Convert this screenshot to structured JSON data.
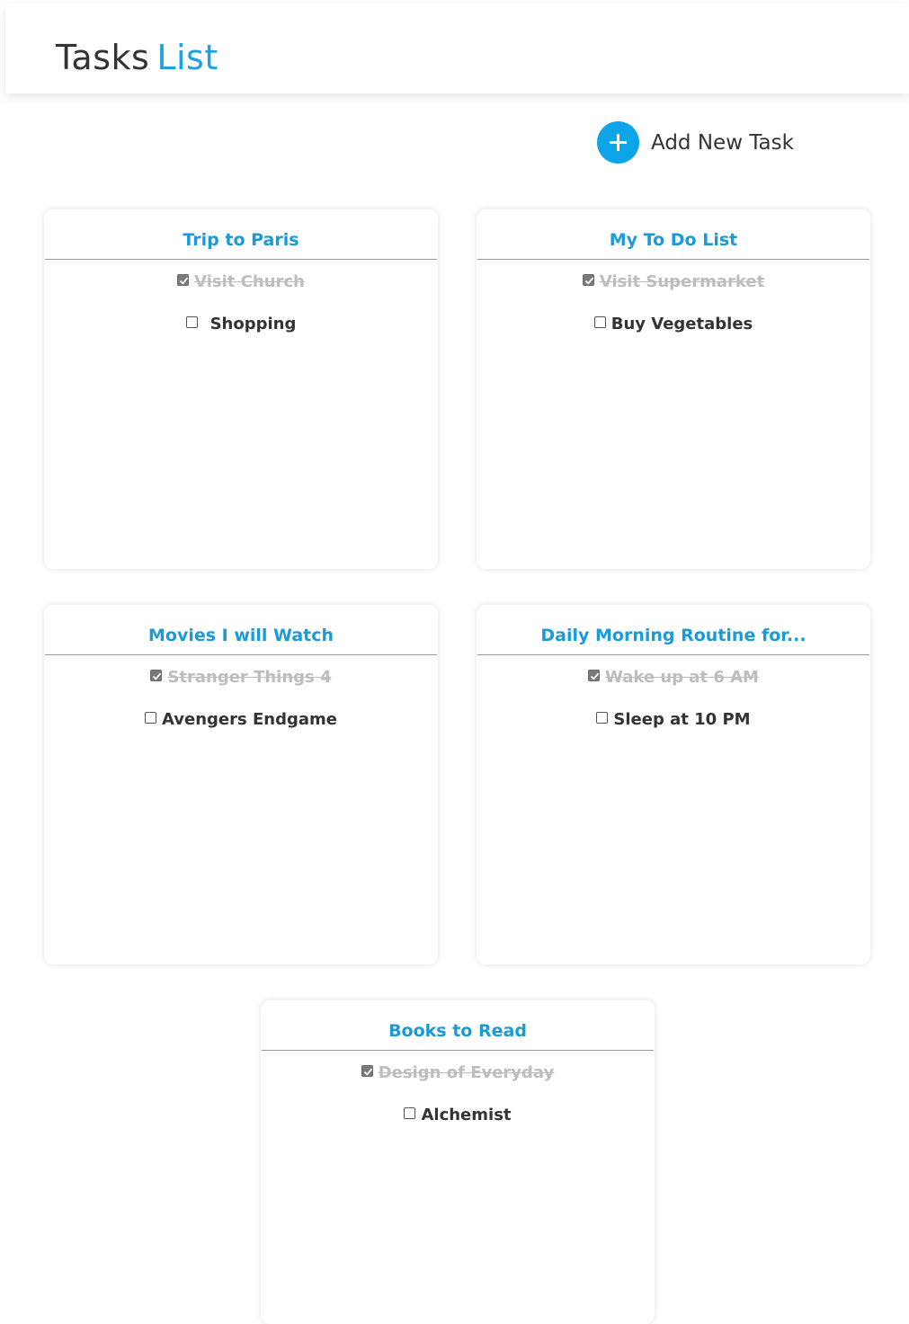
{
  "header": {
    "title_part1": "Tasks",
    "title_part2": "List"
  },
  "add_task": {
    "label": "Add New Task",
    "icon": "plus-icon"
  },
  "colors": {
    "accent": "#1da1e2",
    "add_button": "#0ea4e8",
    "heading_text": "#333333",
    "done_text": "#bdbdbd"
  },
  "lists": [
    {
      "title": "Trip to Paris",
      "tasks": [
        {
          "label": "Visit Church",
          "done": true
        },
        {
          "label": "Shopping",
          "done": false
        }
      ]
    },
    {
      "title": "My To Do List",
      "tasks": [
        {
          "label": "Visit Supermarket",
          "done": true
        },
        {
          "label": "Buy Vegetables",
          "done": false
        }
      ]
    },
    {
      "title": "Movies I will Watch",
      "tasks": [
        {
          "label": "Stranger Things 4",
          "done": true
        },
        {
          "label": "Avengers Endgame",
          "done": false
        }
      ]
    },
    {
      "title": "Daily Morning Routine for...",
      "tasks": [
        {
          "label": "Wake up at 6 AM",
          "done": true
        },
        {
          "label": "Sleep at 10 PM",
          "done": false
        }
      ]
    },
    {
      "title": "Books to Read",
      "tasks": [
        {
          "label": "Design of Everyday",
          "done": true
        },
        {
          "label": "Alchemist",
          "done": false
        }
      ]
    }
  ]
}
